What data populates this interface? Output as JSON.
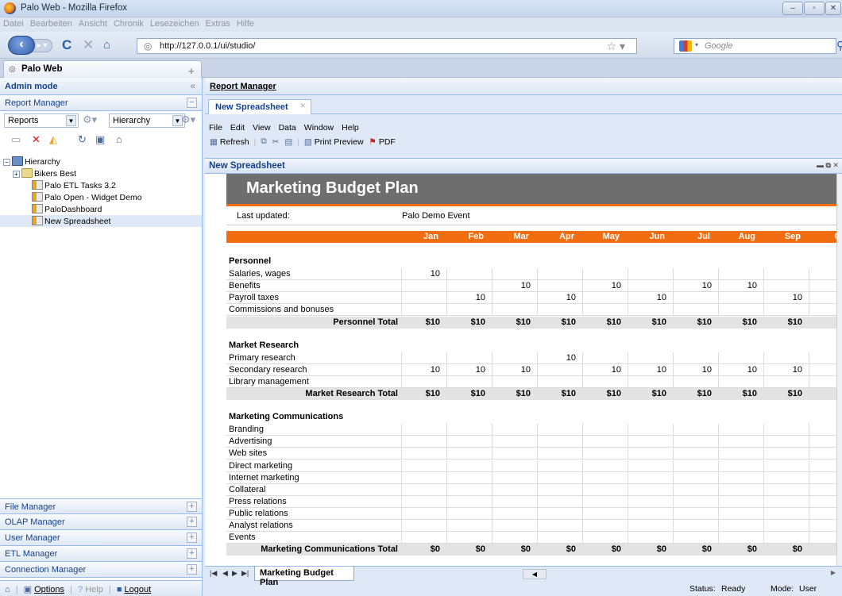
{
  "window": {
    "title": "Palo Web - Mozilla Firefox"
  },
  "firefox_menu": [
    "Datei",
    "Bearbeiten",
    "Ansicht",
    "Chronik",
    "Lesezeichen",
    "Extras",
    "Hilfe"
  ],
  "address": {
    "url": "http://127.0.0.1/ui/studio/",
    "search_placeholder": "Google"
  },
  "browser_tab": {
    "label": "Palo Web"
  },
  "left_panel": {
    "title": "Admin mode",
    "report_manager": "Report Manager",
    "reports_select": "Reports",
    "hierarchy_select": "Hierarchy",
    "tree": {
      "root": "Hierarchy",
      "items": [
        "Bikers Best",
        "Palo ETL Tasks 3.2",
        "Palo Open - Widget Demo",
        "PaloDashboard",
        "New Spreadsheet"
      ]
    },
    "accordion": [
      "File Manager",
      "OLAP Manager",
      "User Manager",
      "ETL Manager",
      "Connection Manager"
    ],
    "bottom": {
      "options": "Options",
      "help": "Help",
      "logout": "Logout"
    }
  },
  "right_panel": {
    "title": "Report Manager",
    "doc_tab": "New Spreadsheet",
    "menu": [
      "File",
      "Edit",
      "View",
      "Data",
      "Window",
      "Help"
    ],
    "toolbar": {
      "refresh": "Refresh",
      "print_preview": "Print Preview",
      "pdf": "PDF"
    },
    "section_title": "New Spreadsheet",
    "sheet_tab": "Marketing Budget Plan",
    "status_label": "Status:",
    "status_value": "Ready",
    "mode_label": "Mode:",
    "mode_value": "User"
  },
  "spreadsheet": {
    "title": "Marketing Budget Plan",
    "last_updated_label": "Last updated:",
    "last_updated_value": "Palo Demo Event",
    "months": [
      "Jan",
      "Feb",
      "Mar",
      "Apr",
      "May",
      "Jun",
      "Jul",
      "Aug",
      "Sep",
      "Oc"
    ],
    "colors": {
      "title_bg": "#6e6e6e",
      "orange": "#f26c10",
      "total_bg": "#e3e3e3"
    },
    "sections": [
      {
        "name": "Personnel",
        "rows": [
          {
            "label": "Salaries, wages",
            "values": [
              "10",
              "",
              "",
              "",
              "",
              "",
              "",
              "",
              "",
              ""
            ]
          },
          {
            "label": "Benefits",
            "values": [
              "",
              "",
              "10",
              "",
              "10",
              "",
              "10",
              "10",
              "",
              ""
            ]
          },
          {
            "label": "Payroll taxes",
            "values": [
              "",
              "10",
              "",
              "10",
              "",
              "10",
              "",
              "",
              "10",
              ""
            ]
          },
          {
            "label": "Commissions and bonuses",
            "values": [
              "",
              "",
              "",
              "",
              "",
              "",
              "",
              "",
              "",
              ""
            ]
          }
        ],
        "total_label": "Personnel Total",
        "totals": [
          "$10",
          "$10",
          "$10",
          "$10",
          "$10",
          "$10",
          "$10",
          "$10",
          "$10",
          ""
        ]
      },
      {
        "name": "Market Research",
        "rows": [
          {
            "label": "Primary research",
            "values": [
              "",
              "",
              "",
              "10",
              "",
              "",
              "",
              "",
              "",
              ""
            ]
          },
          {
            "label": "Secondary research",
            "values": [
              "10",
              "10",
              "10",
              "",
              "10",
              "10",
              "10",
              "10",
              "10",
              ""
            ]
          },
          {
            "label": "Library management",
            "values": [
              "",
              "",
              "",
              "",
              "",
              "",
              "",
              "",
              "",
              ""
            ]
          }
        ],
        "total_label": "Market Research Total",
        "totals": [
          "$10",
          "$10",
          "$10",
          "$10",
          "$10",
          "$10",
          "$10",
          "$10",
          "$10",
          ""
        ]
      },
      {
        "name": "Marketing Communications",
        "rows": [
          {
            "label": "Branding",
            "values": [
              "",
              "",
              "",
              "",
              "",
              "",
              "",
              "",
              "",
              ""
            ]
          },
          {
            "label": "Advertising",
            "values": [
              "",
              "",
              "",
              "",
              "",
              "",
              "",
              "",
              "",
              ""
            ]
          },
          {
            "label": "Web sites",
            "values": [
              "",
              "",
              "",
              "",
              "",
              "",
              "",
              "",
              "",
              ""
            ]
          },
          {
            "label": "Direct marketing",
            "values": [
              "",
              "",
              "",
              "",
              "",
              "",
              "",
              "",
              "",
              ""
            ]
          },
          {
            "label": "Internet marketing",
            "values": [
              "",
              "",
              "",
              "",
              "",
              "",
              "",
              "",
              "",
              ""
            ]
          },
          {
            "label": "Collateral",
            "values": [
              "",
              "",
              "",
              "",
              "",
              "",
              "",
              "",
              "",
              ""
            ]
          },
          {
            "label": "Press relations",
            "values": [
              "",
              "",
              "",
              "",
              "",
              "",
              "",
              "",
              "",
              ""
            ]
          },
          {
            "label": "Public relations",
            "values": [
              "",
              "",
              "",
              "",
              "",
              "",
              "",
              "",
              "",
              ""
            ]
          },
          {
            "label": "Analyst relations",
            "values": [
              "",
              "",
              "",
              "",
              "",
              "",
              "",
              "",
              "",
              ""
            ]
          },
          {
            "label": "Events",
            "values": [
              "",
              "",
              "",
              "",
              "",
              "",
              "",
              "",
              "",
              ""
            ]
          }
        ],
        "total_label": "Marketing Communications Total",
        "totals": [
          "$0",
          "$0",
          "$0",
          "$0",
          "$0",
          "$0",
          "$0",
          "$0",
          "$0",
          ""
        ]
      }
    ]
  }
}
